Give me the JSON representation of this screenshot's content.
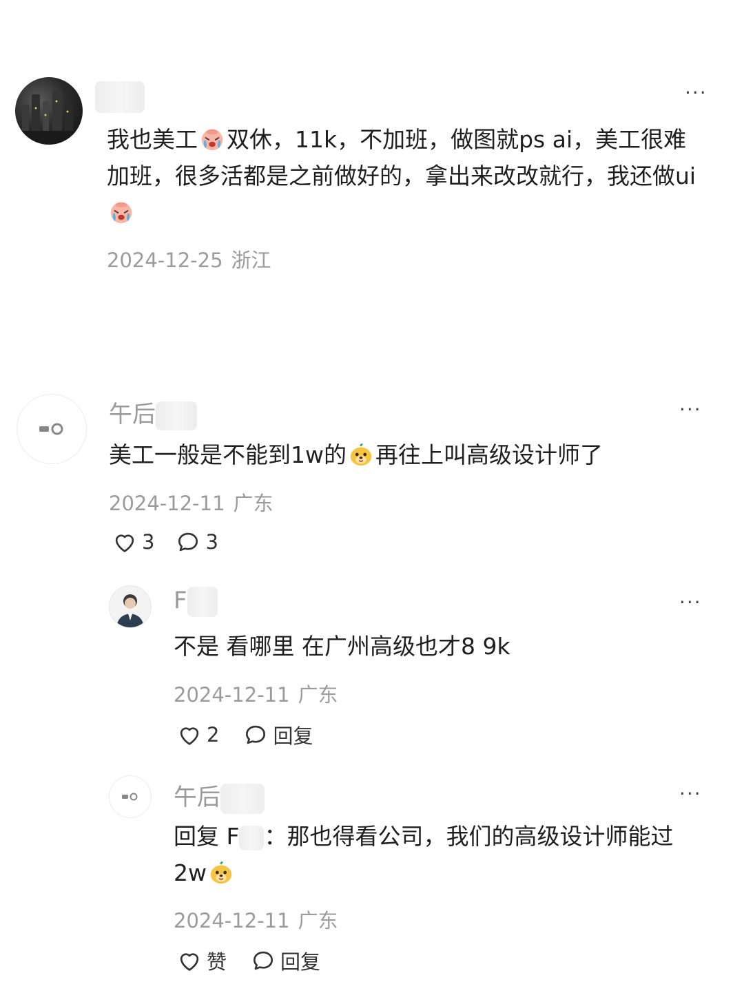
{
  "comments": [
    {
      "username": "",
      "text_parts": [
        "我也美工",
        "双休，11k，不加班，做图就ps ai，美工很难加班，很多活都是之前做好的，拿出来改改就行，我还做ui"
      ],
      "emoji": "crying-face",
      "date": "2024-12-25",
      "location": "浙江"
    },
    {
      "username": "午后",
      "text_parts": [
        "美工一般是不能到1w的",
        "再往上叫高级设计师了"
      ],
      "emoji": "dog-face",
      "date": "2024-12-11",
      "location": "广东",
      "likes": "3",
      "replies": "3",
      "sub_replies": [
        {
          "username": "F",
          "text": "不是 看哪里 在广州高级也才8 9k",
          "date": "2024-12-11",
          "location": "广东",
          "likes": "2",
          "reply_label": "回复"
        },
        {
          "username": "午后",
          "reply_prefix": "回复 F",
          "text_parts": [
            "：那也得看公司，我们的高级设计师能过2w"
          ],
          "emoji": "dog-face",
          "date": "2024-12-11",
          "location": "广东",
          "like_label": "赞",
          "reply_label": "回复"
        }
      ]
    }
  ],
  "more_icon": "···",
  "colors": {
    "meta": "#9b9b9b",
    "username": "#9a9a9a",
    "text": "#1f1f1f"
  }
}
